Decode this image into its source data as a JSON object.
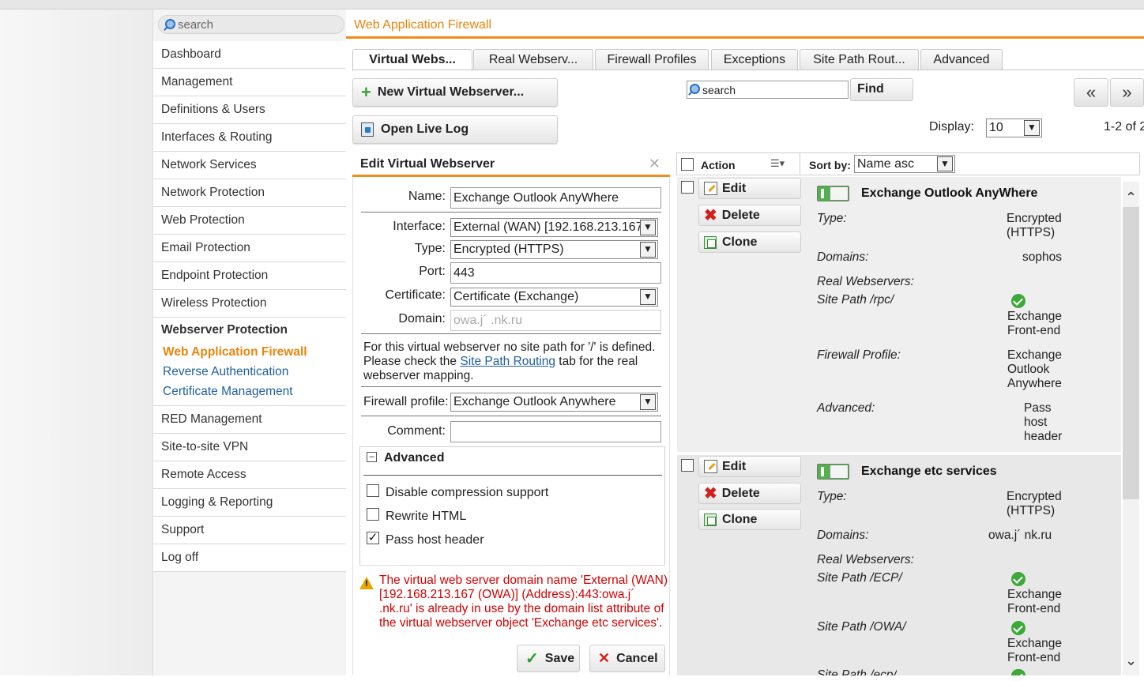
{
  "sidebar": {
    "search_placeholder": "search",
    "items": [
      {
        "label": "Dashboard"
      },
      {
        "label": "Management"
      },
      {
        "label": "Definitions & Users"
      },
      {
        "label": "Interfaces & Routing"
      },
      {
        "label": "Network Services"
      },
      {
        "label": "Network Protection"
      },
      {
        "label": "Web Protection"
      },
      {
        "label": "Email Protection"
      },
      {
        "label": "Endpoint Protection"
      },
      {
        "label": "Wireless Protection"
      }
    ],
    "group": {
      "label": "Webserver Protection",
      "subitems": [
        {
          "label": "Web Application Firewall",
          "active": true
        },
        {
          "label": "Reverse Authentication"
        },
        {
          "label": "Certificate Management"
        }
      ]
    },
    "items_after": [
      {
        "label": "RED Management"
      },
      {
        "label": "Site-to-site VPN"
      },
      {
        "label": "Remote Access"
      },
      {
        "label": "Logging & Reporting"
      },
      {
        "label": "Support"
      },
      {
        "label": "Log off"
      }
    ]
  },
  "page_title": "Web Application Firewall",
  "tabs": [
    {
      "label": "Virtual Webs..."
    },
    {
      "label": "Real Webserv..."
    },
    {
      "label": "Firewall Profiles"
    },
    {
      "label": "Exceptions"
    },
    {
      "label": "Site Path Rout..."
    },
    {
      "label": "Advanced"
    }
  ],
  "toolbar": {
    "new_button": "New Virtual Webserver...",
    "log_button": "Open Live Log",
    "search_placeholder": "search",
    "find_button": "Find",
    "prev_page": "«",
    "next_page": "»",
    "display_label": "Display:",
    "display_value": "10",
    "count": "1-2 of 2"
  },
  "edit": {
    "title": "Edit Virtual Webserver",
    "close": "✕",
    "name_label": "Name:",
    "name_value": "Exchange Outlook AnyWhere",
    "interface_label": "Interface:",
    "interface_value": "External (WAN) [192.168.213.167",
    "type_label": "Type:",
    "type_value": "Encrypted (HTTPS)",
    "port_label": "Port:",
    "port_value": "443",
    "certificate_label": "Certificate:",
    "certificate_value": "Certificate (Exchange)",
    "domain_label": "Domain:",
    "domain_value": "owa.j´ .nk.ru",
    "note_text_1": "For this virtual webserver no site path for '/' is defined. Please check the ",
    "note_link": "Site Path Routing",
    "note_text_2": " tab for the real webserver mapping.",
    "firewall_profile_label": "Firewall profile:",
    "firewall_profile_value": "Exchange Outlook Anywhere",
    "comment_label": "Comment:",
    "comment_value": "",
    "advanced_label": "Advanced",
    "options": [
      {
        "label": "Disable compression support",
        "checked": false
      },
      {
        "label": "Rewrite HTML",
        "checked": false
      },
      {
        "label": "Pass host header",
        "checked": true
      }
    ],
    "error": "The virtual web server domain name 'External (WAN) [192.168.213.167 (OWA)] (Address):443:owa.j´ .nk.ru' is already in use by the domain list attribute of the virtual webserver object 'Exchange etc services'.",
    "save": "Save",
    "cancel": "Cancel"
  },
  "list": {
    "action_label": "Action",
    "sort_label": "Sort by:",
    "sort_value": "Name asc",
    "rows": [
      {
        "edit": "Edit",
        "delete": "Delete",
        "clone": "Clone",
        "name": "Exchange Outlook AnyWhere",
        "type_label": "Type:",
        "type_value": "Encrypted (HTTPS)",
        "domains_label": "Domains:",
        "domains_value": "sophos",
        "real_label": "Real Webservers:",
        "sitepath_label": "Site Path /rpc/",
        "sitepath_value": "Exchange Front-end",
        "profile_label": "Firewall Profile:",
        "profile_value": "Exchange Outlook Anywhere",
        "advanced_label": "Advanced:",
        "advanced_value": "Pass host header"
      },
      {
        "edit": "Edit",
        "delete": "Delete",
        "clone": "Clone",
        "name": "Exchange etc services",
        "type_label": "Type:",
        "type_value": "Encrypted (HTTPS)",
        "domains_label": "Domains:",
        "domains_value": "owa.j´ nk.ru",
        "real_label": "Real Webservers:",
        "sitepath1_label": "Site Path /ECP/",
        "sitepath1_value": "Exchange Front-end",
        "sitepath2_label": "Site Path /OWA/",
        "sitepath2_value": "Exchange Front-end",
        "sitepath3_label": "Site Path /ecp/"
      }
    ]
  },
  "colors": {
    "accent": "#e8850c",
    "error": "#d40000",
    "link": "#1f5f9e",
    "ok": "#3ea83a"
  }
}
